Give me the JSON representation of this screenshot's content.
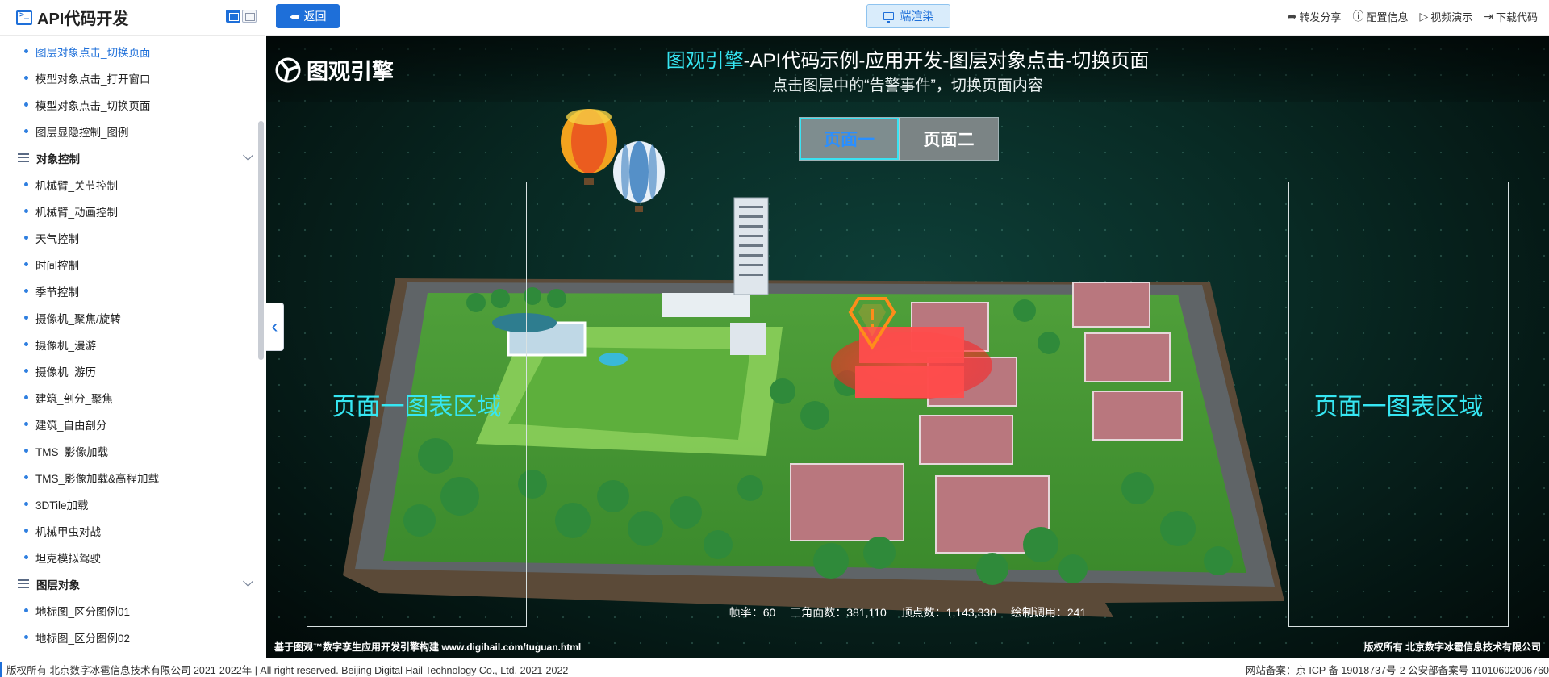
{
  "app": {
    "title": "API代码开发"
  },
  "sidebar": {
    "items": [
      {
        "type": "item",
        "label": "图层对象点击_切换页面",
        "active": true
      },
      {
        "type": "item",
        "label": "模型对象点击_打开窗口"
      },
      {
        "type": "item",
        "label": "模型对象点击_切换页面"
      },
      {
        "type": "item",
        "label": "图层显隐控制_图例"
      },
      {
        "type": "group",
        "label": "对象控制"
      },
      {
        "type": "item",
        "label": "机械臂_关节控制"
      },
      {
        "type": "item",
        "label": "机械臂_动画控制"
      },
      {
        "type": "item",
        "label": "天气控制"
      },
      {
        "type": "item",
        "label": "时间控制"
      },
      {
        "type": "item",
        "label": "季节控制"
      },
      {
        "type": "item",
        "label": "摄像机_聚焦/旋转"
      },
      {
        "type": "item",
        "label": "摄像机_漫游"
      },
      {
        "type": "item",
        "label": "摄像机_游历"
      },
      {
        "type": "item",
        "label": "建筑_剖分_聚焦"
      },
      {
        "type": "item",
        "label": "建筑_自由剖分"
      },
      {
        "type": "item",
        "label": "TMS_影像加载"
      },
      {
        "type": "item",
        "label": "TMS_影像加载&高程加载"
      },
      {
        "type": "item",
        "label": "3DTile加载"
      },
      {
        "type": "item",
        "label": "机械甲虫对战"
      },
      {
        "type": "item",
        "label": "坦克模拟驾驶"
      },
      {
        "type": "group",
        "label": "图层对象"
      },
      {
        "type": "item",
        "label": "地标图_区分图例01"
      },
      {
        "type": "item",
        "label": "地标图_区分图例02"
      }
    ]
  },
  "topbar": {
    "back_label": "返回",
    "render_label": "端渲染",
    "actions": [
      {
        "label": "转发分享",
        "icon": "share-icon"
      },
      {
        "label": "配置信息",
        "icon": "info-icon"
      },
      {
        "label": "视频演示",
        "icon": "play-icon"
      },
      {
        "label": "下载代码",
        "icon": "download-icon"
      }
    ]
  },
  "viewer": {
    "brand": "图观引擎",
    "title_accent": "图观引擎",
    "title_rest": "-API代码示例-应用开发-图层对象点击-切换页面",
    "subtitle": "点击图层中的“告警事件”，切换页面内容",
    "tabs": [
      "页面一",
      "页面二"
    ],
    "active_tab": 0,
    "chart_left": "页面一图表区域",
    "chart_right": "页面一图表区域",
    "stats": {
      "fps": "帧率：60",
      "triangles": "三角面数：381,110",
      "vertices": "顶点数：1,143,330",
      "drawcalls": "绘制调用：241"
    },
    "footnote_left": "基于图观™数字孪生应用开发引擎构建 www.digihail.com/tuguan.html",
    "footnote_right": "版权所有 北京数字冰雹信息技术有限公司"
  },
  "footer": {
    "copyright": "版权所有 北京数字冰雹信息技术有限公司 2021-2022年 | All right reserved. Beijing Digital Hail Technology Co., Ltd. 2021-2022",
    "icp": "网站备案：京 ICP 备 19018737号-2 公安部备案号 11010602006760"
  },
  "colors": {
    "accent": "#1e6fd9",
    "cyan": "#36e6f2",
    "alarm": "#ff3030"
  }
}
